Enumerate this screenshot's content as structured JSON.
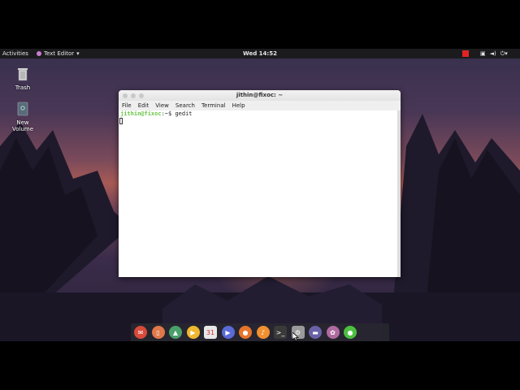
{
  "topbar": {
    "activities": "Activities",
    "app_menu": "Text Editor",
    "app_menu_arrow": "▾",
    "clock": "Wed 14:52",
    "tray_icons": [
      "display-icon",
      "volume-icon",
      "power-icon"
    ]
  },
  "desktop": {
    "icons": [
      {
        "label": "Trash",
        "icon": "trash-icon"
      },
      {
        "label_line1": "New",
        "label_line2": "Volume",
        "icon": "drive-icon"
      }
    ]
  },
  "terminal": {
    "title": "jithin@fixoc: ~",
    "menu": [
      "File",
      "Edit",
      "View",
      "Search",
      "Terminal",
      "Help"
    ],
    "prompt_user": "jithin@fixoc",
    "prompt_path": ":~$",
    "command": "gedit"
  },
  "dock": {
    "items": [
      {
        "name": "gmail-icon",
        "color": "#d84a3a",
        "glyph": "✉"
      },
      {
        "name": "phone-app-icon",
        "color": "#e0784a",
        "glyph": "▯"
      },
      {
        "name": "photos-icon",
        "color": "#4aa06a",
        "glyph": "▲"
      },
      {
        "name": "video-player-icon",
        "color": "#f0b830",
        "glyph": "▶"
      },
      {
        "name": "calendar-icon",
        "color": "#e8e8e8",
        "glyph": "31"
      },
      {
        "name": "media-player-icon",
        "color": "#5a6ad8",
        "glyph": "▶"
      },
      {
        "name": "firefox-icon",
        "color": "#e8742a",
        "glyph": "●"
      },
      {
        "name": "music-icon",
        "color": "#f09030",
        "glyph": "♪"
      },
      {
        "name": "terminal-icon",
        "color": "#3a3a3a",
        "glyph": ">_"
      },
      {
        "name": "system-settings-icon",
        "color": "#9a9a9a",
        "glyph": "⚙"
      },
      {
        "name": "files-icon",
        "color": "#6a62a8",
        "glyph": "▬"
      },
      {
        "name": "software-icon",
        "color": "#b06aa0",
        "glyph": "✿"
      },
      {
        "name": "app-green-icon",
        "color": "#4cc040",
        "glyph": "●"
      }
    ]
  }
}
